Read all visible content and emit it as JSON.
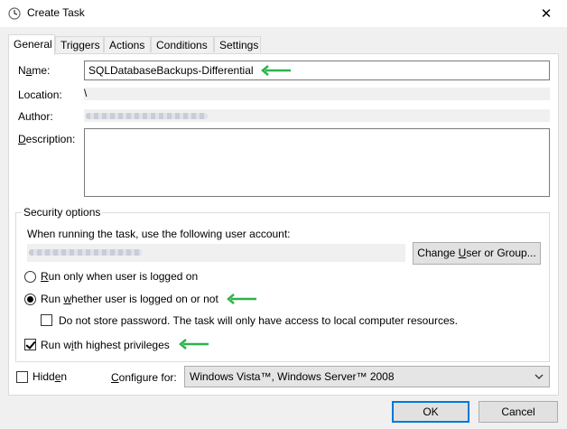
{
  "window": {
    "title": "Create Task",
    "close_glyph": "✕"
  },
  "tabs": [
    "General",
    "Triggers",
    "Actions",
    "Conditions",
    "Settings"
  ],
  "general": {
    "name_label_pre": "N",
    "name_label_under": "a",
    "name_label_post": "me:",
    "name_value": "SQLDatabaseBackups-Differential",
    "location_label": "Location:",
    "location_value": "\\",
    "author_label": "Author:",
    "description_label_under": "D",
    "description_label_post": "escription:"
  },
  "security": {
    "group_title": "Security options",
    "account_prompt": "When running the task, use the following user account:",
    "change_user_button": {
      "pre": "Change ",
      "under": "U",
      "post": "ser or Group..."
    },
    "radio_logged_on": {
      "under": "R",
      "post": "un only when user is logged on",
      "checked": false
    },
    "radio_whether": {
      "pre": "Run ",
      "under": "w",
      "post": "hether user is logged on or not",
      "checked": true
    },
    "checkbox_no_store": {
      "pre": "Do not store password.  The task will only have access to local computer resources.",
      "checked": false
    },
    "checkbox_highest": {
      "pre": "Run w",
      "under": "i",
      "post": "th highest privileges",
      "checked": true
    }
  },
  "bottom": {
    "hidden_label_pre": "Hidd",
    "hidden_label_under": "e",
    "hidden_label_post": "n",
    "hidden_checked": false,
    "configure_label_under": "C",
    "configure_label_post": "onfigure for:",
    "configure_value": "Windows Vista™, Windows Server™ 2008"
  },
  "footer": {
    "ok": "OK",
    "cancel": "Cancel"
  },
  "colors": {
    "annotation_arrow": "#2db34a",
    "accent": "#0078d7"
  },
  "icons": [
    "clock-icon",
    "close-icon",
    "chevron-down-icon",
    "green-arrow-icon"
  ]
}
